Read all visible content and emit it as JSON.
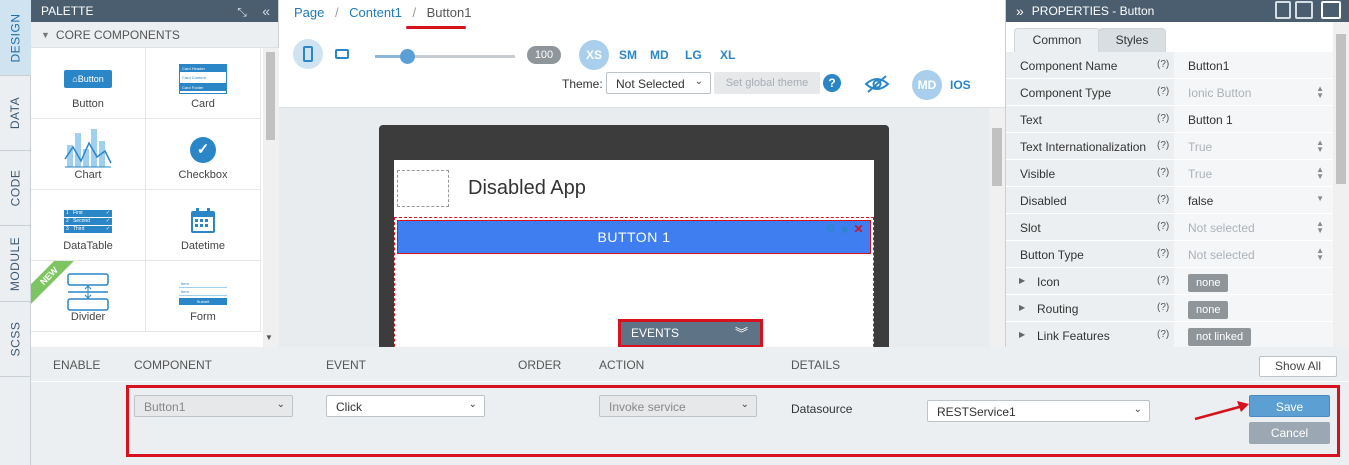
{
  "side_tabs": [
    "DESIGN",
    "DATA",
    "CODE",
    "MODULE",
    "SCSS"
  ],
  "palette": {
    "title": "PALETTE",
    "section": "CORE COMPONENTS",
    "items": [
      {
        "label": "Button",
        "icon": "button-icon",
        "thumb": "Button"
      },
      {
        "label": "Card",
        "icon": "card-icon",
        "thumb_lines": [
          "Card Header",
          "Card Content",
          "Card Footer"
        ]
      },
      {
        "label": "Chart",
        "icon": "chart-icon"
      },
      {
        "label": "Checkbox",
        "icon": "checkbox-icon"
      },
      {
        "label": "DataTable",
        "icon": "datatable-icon",
        "thumb_lines": [
          "First",
          "Second",
          "Third"
        ]
      },
      {
        "label": "Datetime",
        "icon": "calendar-icon"
      },
      {
        "label": "Divider",
        "icon": "divider-icon",
        "badge": "NEW"
      },
      {
        "label": "Form",
        "icon": "form-icon",
        "thumb_lines": [
          "Item",
          "Item",
          "Submit"
        ]
      }
    ]
  },
  "breadcrumb": [
    "Page",
    "Content1",
    "Button1"
  ],
  "toolbar": {
    "zoom": "100",
    "zoom_fraction": 0.23,
    "sizes": [
      "XS",
      "SM",
      "MD",
      "LG",
      "XL"
    ],
    "active_size": "XS",
    "theme_label": "Theme:",
    "theme_value": "Not Selected",
    "global_theme_button": "Set global theme",
    "help": "?",
    "modes": [
      "MD",
      "IOS"
    ]
  },
  "canvas": {
    "app_title": "Disabled App",
    "button_label": "BUTTON 1",
    "events_tab": "EVENTS"
  },
  "properties": {
    "title": "PROPERTIES - Button",
    "tabs": [
      "Common",
      "Styles"
    ],
    "rows": [
      {
        "name": "Component Name",
        "value": "Button1",
        "kind": "text"
      },
      {
        "name": "Component Type",
        "value": "Ionic Button",
        "kind": "dim-updown"
      },
      {
        "name": "Text",
        "value": "Button 1",
        "kind": "text"
      },
      {
        "name": "Text Internationalization",
        "value": "True",
        "kind": "dim-updown"
      },
      {
        "name": "Visible",
        "value": "True",
        "kind": "dim-updown"
      },
      {
        "name": "Disabled",
        "value": "false",
        "kind": "dropdown"
      },
      {
        "name": "Slot",
        "value": "Not selected",
        "kind": "dim-updown"
      },
      {
        "name": "Button Type",
        "value": "Not selected",
        "kind": "dim-updown"
      },
      {
        "name": "Icon",
        "value": "none",
        "kind": "pill"
      },
      {
        "name": "Routing",
        "value": "none",
        "kind": "pill"
      },
      {
        "name": "Link Features",
        "value": "not linked",
        "kind": "pill"
      }
    ],
    "help": "(?)"
  },
  "events": {
    "headers": [
      "ENABLE",
      "COMPONENT",
      "EVENT",
      "ORDER",
      "ACTION",
      "DETAILS"
    ],
    "show_all": "Show All",
    "component": "Button1",
    "event": "Click",
    "action": "Invoke service",
    "details_label": "Datasource",
    "datasource": "RESTService1",
    "save": "Save",
    "cancel": "Cancel"
  },
  "colors": {
    "header": "#4a5e70",
    "accent": "#2a86c6",
    "button_blue": "#3f7ef0",
    "highlight": "#d6121e",
    "save": "#5b9fd3",
    "cancel": "#9ba8b3"
  }
}
